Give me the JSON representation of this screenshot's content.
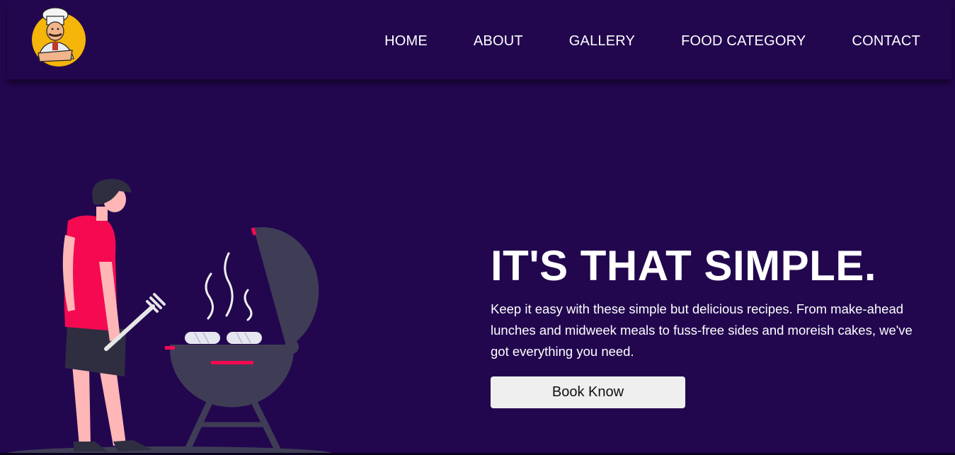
{
  "nav": {
    "logo_icon": "chef-logo-icon",
    "links": [
      "HOME",
      "ABOUT",
      "GALLERY",
      "FOOD CATEGORY",
      "CONTACT"
    ]
  },
  "hero": {
    "title": "IT'S THAT SIMPLE.",
    "description": "Keep it easy with these simple but delicious recipes. From make-ahead lunches and midweek meals to fuss-free sides and moreish cakes, we've got everything you need.",
    "button_label": "Book Know",
    "illustration_icon": "barbecue-grill-illustration"
  },
  "colors": {
    "background": "#22074f",
    "accent": "#f50a52",
    "grill": "#3f3d56",
    "button": "#efefef"
  }
}
